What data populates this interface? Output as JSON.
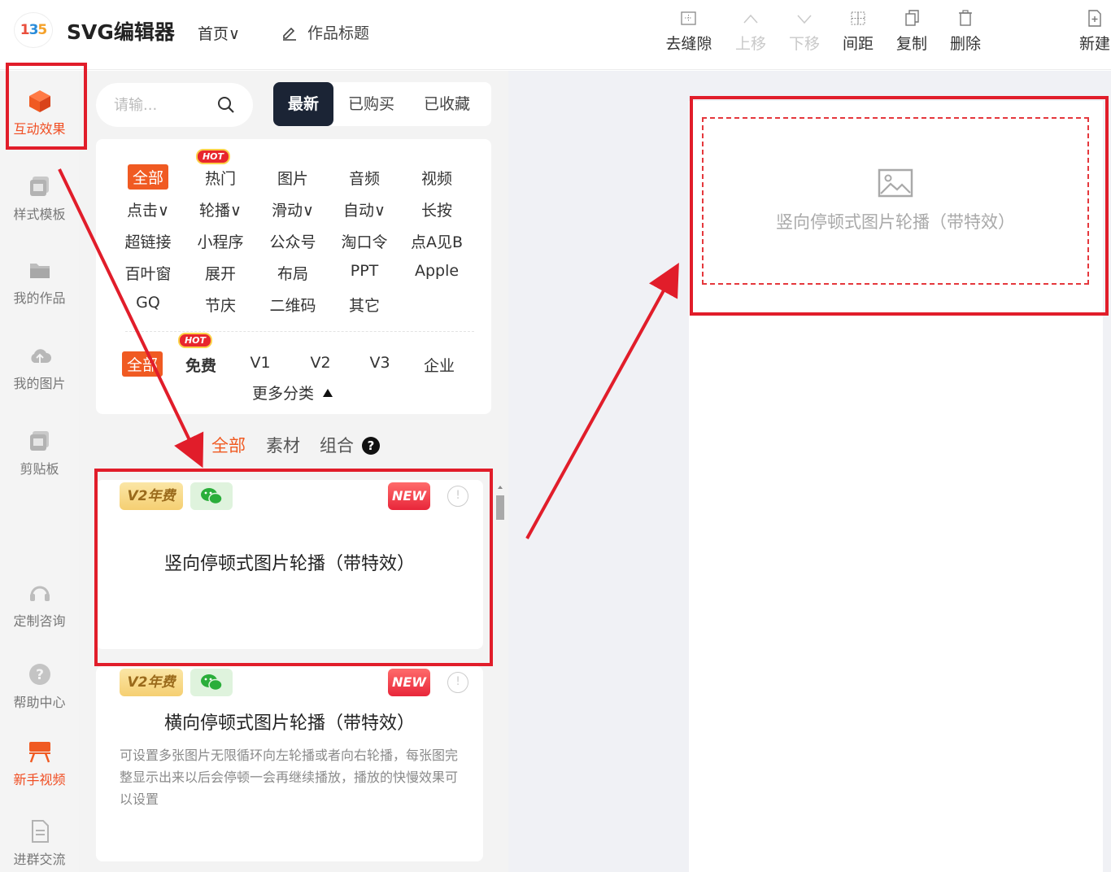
{
  "header": {
    "app_title": "SVG编辑器",
    "home_menu": "首页∨",
    "work_title": "作品标题"
  },
  "toolbar": [
    {
      "id": "remove-gap",
      "label": "去缝隙",
      "icon": "dotted-square-icon",
      "disabled": false
    },
    {
      "id": "move-up",
      "label": "上移",
      "icon": "chevron-up-icon",
      "disabled": true
    },
    {
      "id": "move-down",
      "label": "下移",
      "icon": "chevron-down-icon",
      "disabled": true
    },
    {
      "id": "spacing",
      "label": "间距",
      "icon": "spacing-grid-icon",
      "disabled": false
    },
    {
      "id": "copy",
      "label": "复制",
      "icon": "copy-icon",
      "disabled": false
    },
    {
      "id": "delete",
      "label": "删除",
      "icon": "trash-icon",
      "disabled": false
    },
    {
      "id": "new",
      "label": "新建",
      "icon": "new-file-icon",
      "disabled": false
    }
  ],
  "sidebar": [
    {
      "label": "互动效果",
      "icon": "cube-icon",
      "active": true
    },
    {
      "label": "样式模板",
      "icon": "template-icon"
    },
    {
      "label": "我的作品",
      "icon": "folder-icon"
    },
    {
      "label": "我的图片",
      "icon": "cloud-icon"
    },
    {
      "label": "剪贴板",
      "icon": "clipboard-icon"
    },
    {
      "label": "定制咨询",
      "icon": "headset-icon"
    },
    {
      "label": "帮助中心",
      "icon": "help-circle-icon"
    },
    {
      "label": "新手视频",
      "icon": "video-icon",
      "active": true
    },
    {
      "label": "进群交流",
      "icon": "document-icon"
    }
  ],
  "search": {
    "placeholder": "请输..."
  },
  "tabs": [
    "最新",
    "已购买",
    "已收藏"
  ],
  "categories": {
    "rows": [
      [
        "全部",
        "热门",
        "图片",
        "音频",
        "视频"
      ],
      [
        "点击∨",
        "轮播∨",
        "滑动∨",
        "自动∨",
        "长按"
      ],
      [
        "超链接",
        "小程序",
        "公众号",
        "淘口令",
        "点A见B"
      ],
      [
        "百叶窗",
        "展开",
        "布局",
        "PPT",
        "Apple"
      ],
      [
        "GQ",
        "节庆",
        "二维码",
        "其它"
      ]
    ],
    "hot_label": "HOT",
    "versions": [
      "全部",
      "免费",
      "V1",
      "V2",
      "V3",
      "企业"
    ],
    "more": "更多分类"
  },
  "filter": [
    "全部",
    "素材",
    "组合"
  ],
  "filter_help": "?",
  "cards": [
    {
      "badge_v2": "V2年费",
      "badge_new": "NEW",
      "info": "!",
      "title": "竖向停顿式图片轮播（带特效）",
      "desc": ""
    },
    {
      "badge_v2": "V2年费",
      "badge_new": "NEW",
      "info": "!",
      "title": "横向停顿式图片轮播（带特效）",
      "desc": "可设置多张图片无限循环向左轮播或者向右轮播，每张图完整显示出来以后会停顿一会再继续播放，播放的快慢效果可以设置"
    }
  ],
  "canvas": {
    "placeholder": "竖向停顿式图片轮播（带特效）"
  },
  "colors": {
    "accent": "#f05a22",
    "annotation": "#e11d2a",
    "dark_tab": "#1b2435"
  }
}
